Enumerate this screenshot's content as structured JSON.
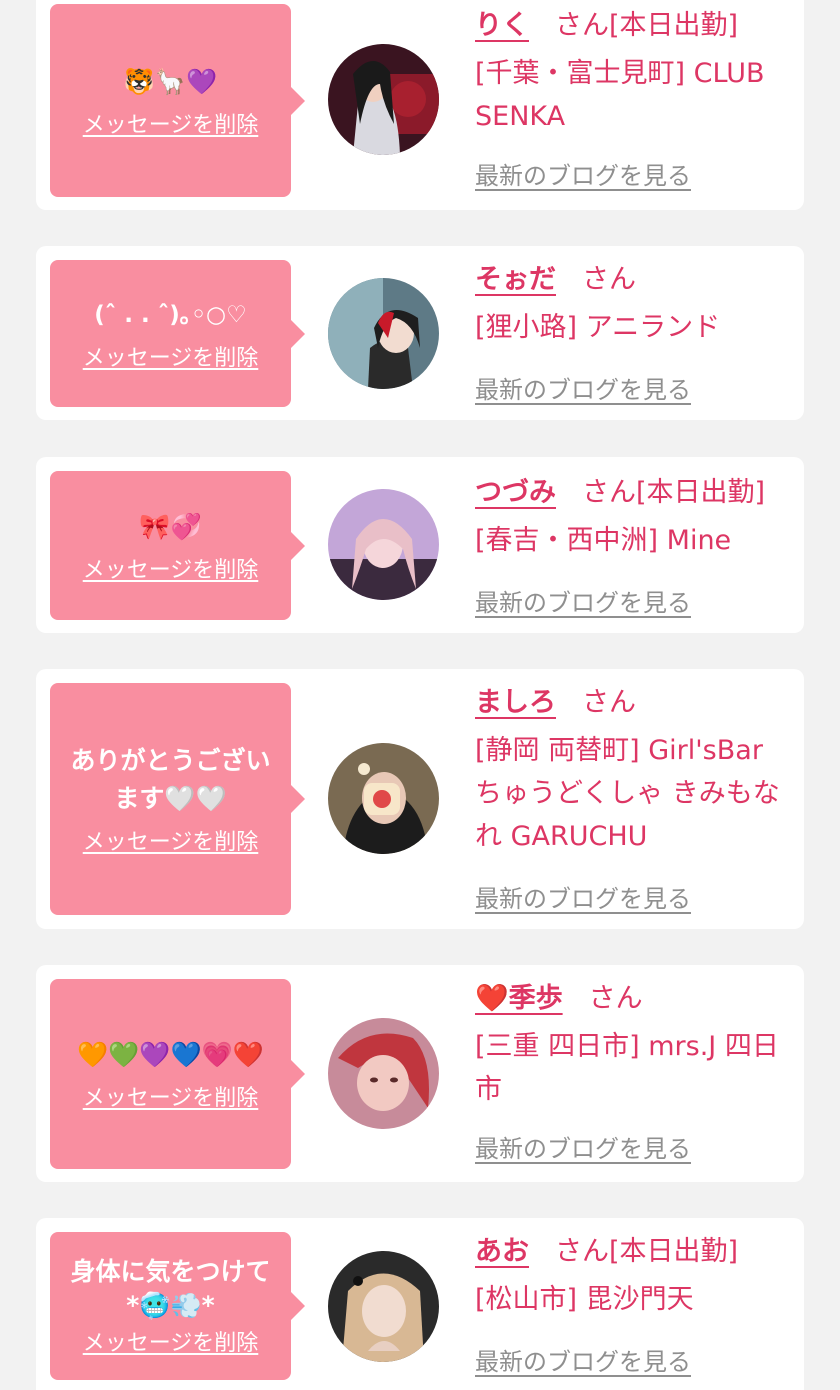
{
  "delete_label": "メッセージを削除",
  "blog_label": "最新のブログを見る",
  "san_label": "さん",
  "colors": {
    "background": "#f2f2f2",
    "bubble": "#f98ea0",
    "accent_text": "#dd3664",
    "link_gray": "#8f8f8f"
  },
  "items": [
    {
      "message": "🐯🦙💜",
      "name": "りく",
      "status": "[本日出勤]",
      "place": "[千葉・富士見町] CLUB SENKA"
    },
    {
      "message": "(ˆ . . ˆ)｡◦○♡",
      "name": "そぉだ",
      "status": "",
      "place": "[狸小路] アニランド"
    },
    {
      "message": "🎀💞",
      "name": "つづみ",
      "status": "[本日出勤]",
      "place": "[春吉・西中洲] Mine"
    },
    {
      "message": "ありがとうございます🤍🤍",
      "name": "ましろ",
      "status": "",
      "place": "[静岡 両替町] Girl'sBar ちゅうどくしゃ きみもなれ GARUCHU"
    },
    {
      "message": "🧡💚💜💙💗❤️",
      "name": "❤️季歩",
      "status": "",
      "place": "[三重 四日市] mrs.J 四日市"
    },
    {
      "message": "身体に気をつけて *🥶💨*",
      "name": "あお",
      "status": "[本日出勤]",
      "place": "[松山市] 毘沙門天"
    }
  ]
}
